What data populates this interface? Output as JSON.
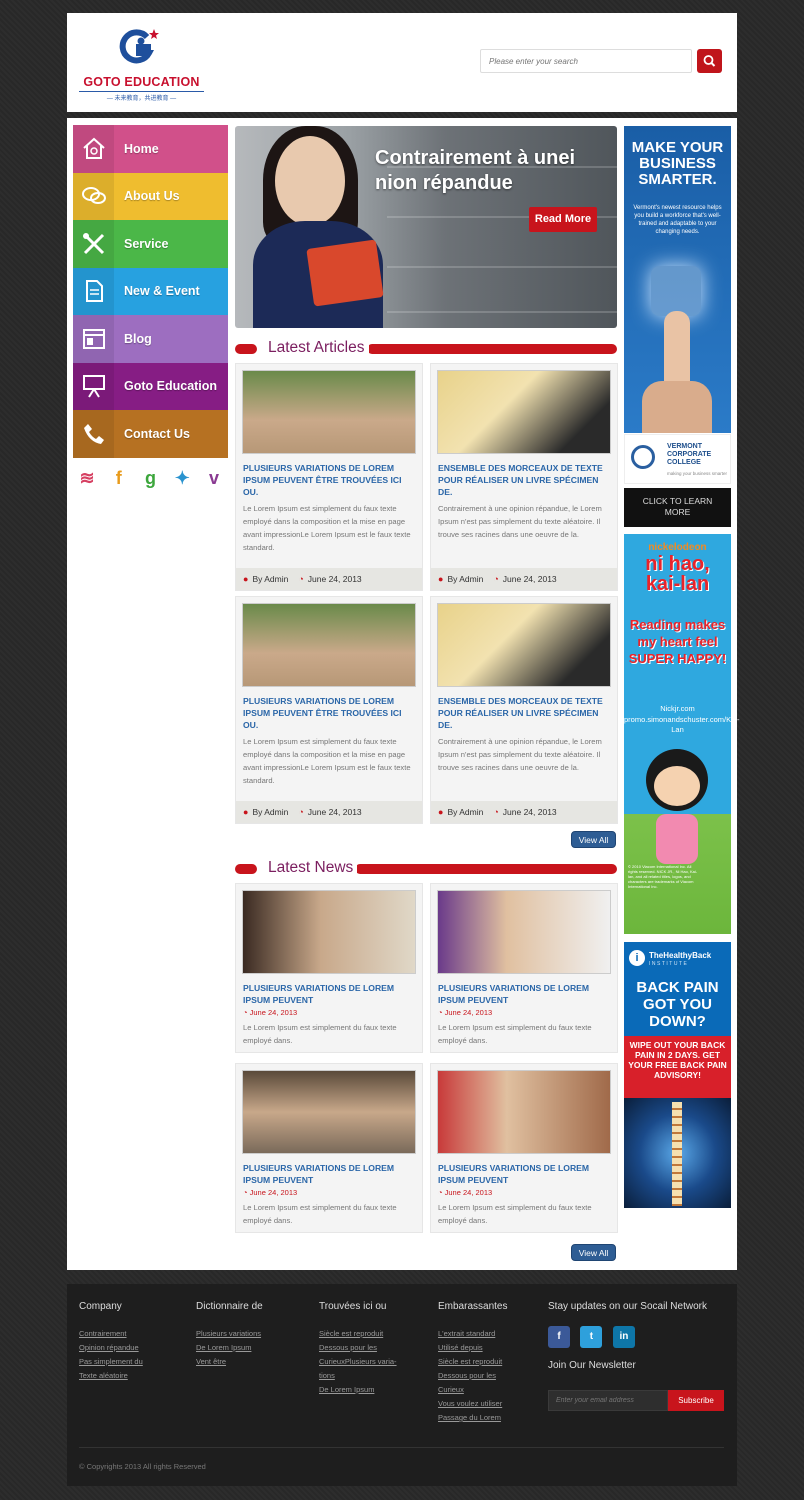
{
  "brand": {
    "name": "GOTO EDUCATION",
    "tagline": "— 未来教育，共进教育 —"
  },
  "search": {
    "placeholder": "Please enter your search"
  },
  "nav": [
    {
      "label": "Home",
      "icon": "home-icon",
      "color": "#d1508a"
    },
    {
      "label": "About Us",
      "icon": "chat-icon",
      "color": "#efbd2f"
    },
    {
      "label": "Service",
      "icon": "tools-icon",
      "color": "#4bb748"
    },
    {
      "label": "New & Event",
      "icon": "document-icon",
      "color": "#27a1e0"
    },
    {
      "label": "Blog",
      "icon": "browser-icon",
      "color": "#9d6ec0"
    },
    {
      "label": "Goto Education",
      "icon": "presentation-icon",
      "color": "#861d84"
    },
    {
      "label": "Contact Us",
      "icon": "phone-icon",
      "color": "#b67122"
    }
  ],
  "social_sidebar": [
    {
      "icon": "rss-icon",
      "glyph": "≋",
      "color": "#d64062"
    },
    {
      "icon": "facebook-icon",
      "glyph": "f",
      "color": "#e89b1c"
    },
    {
      "icon": "google-icon",
      "glyph": "g",
      "color": "#3ca63c"
    },
    {
      "icon": "twitter-icon",
      "glyph": "✦",
      "color": "#2a93cf"
    },
    {
      "icon": "vimeo-icon",
      "glyph": "v",
      "color": "#8a3a92"
    }
  ],
  "banner": {
    "title": "Contrairement à unei nion répandue",
    "button": "Read More"
  },
  "latest_articles": {
    "heading": "Latest Articles",
    "items": [
      {
        "title": "PLUSIEURS VARIATIONS DE LOREM IPSUM PEUVENT ÊTRE TROUVÉES ICI OU.",
        "text": "Le Lorem Ipsum est simplement du faux texte employé dans la composition et la mise en page avant impressionLe Lorem Ipsum est le faux texte standard.",
        "author": "By Admin",
        "date": "June 24, 2013"
      },
      {
        "title": "ENSEMBLE DES MORCEAUX DE TEXTE POUR RÉALISER UN LIVRE SPÉCIMEN DE.",
        "text": "Contrairement à une opinion répandue, le Lorem Ipsum n'est pas simplement du texte aléatoire. Il trouve ses racines dans une oeuvre de la.",
        "author": "By Admin",
        "date": "June 24, 2013"
      },
      {
        "title": "PLUSIEURS VARIATIONS DE LOREM IPSUM PEUVENT ÊTRE TROUVÉES ICI OU.",
        "text": "Le Lorem Ipsum est simplement du faux texte employé dans la composition et la mise en page avant impressionLe Lorem Ipsum est le faux texte standard.",
        "author": "By Admin",
        "date": "June 24, 2013"
      },
      {
        "title": "ENSEMBLE DES MORCEAUX DE TEXTE POUR RÉALISER UN LIVRE SPÉCIMEN DE.",
        "text": "Contrairement à une opinion répandue, le Lorem Ipsum n'est pas simplement du texte aléatoire. Il trouve ses racines dans une oeuvre de la.",
        "author": "By Admin",
        "date": "June 24, 2013"
      }
    ],
    "view_all": "View All"
  },
  "latest_news": {
    "heading": "Latest News",
    "items": [
      {
        "title": "PLUSIEURS VARIATIONS DE LOREM IPSUM PEUVENT",
        "date": "June 24, 2013",
        "text": "Le Lorem Ipsum est simplement du faux texte employé dans."
      },
      {
        "title": "PLUSIEURS VARIATIONS DE LOREM IPSUM PEUVENT",
        "date": "June 24, 2013",
        "text": "Le Lorem Ipsum est simplement du faux texte employé dans."
      },
      {
        "title": "PLUSIEURS VARIATIONS DE LOREM IPSUM PEUVENT",
        "date": "June 24, 2013",
        "text": "Le Lorem Ipsum est simplement du faux texte employé dans."
      },
      {
        "title": "PLUSIEURS VARIATIONS DE LOREM IPSUM PEUVENT",
        "date": "June 24, 2013",
        "text": "Le Lorem Ipsum est simplement du faux texte employé dans."
      }
    ],
    "view_all": "View All"
  },
  "ads": {
    "vermont": {
      "headline": "MAKE YOUR BUSINESS SMARTER.",
      "body": "Vermont's newest resource helps you build a workforce that's well-trained and adaptable to your changing needs.",
      "college": "VERMONT CORPORATE COLLEGE",
      "college_sub": "making your business smarter",
      "cta": "CLICK TO LEARN MORE"
    },
    "nihao": {
      "brand": "nickelodeon",
      "title": "ni hao, kai-lan",
      "slogan": "Reading makes my heart feel SUPER HAPPY!",
      "url1": "Nickjr.com",
      "url2": "promo.simonandschuster.com/Kai-Lan",
      "legal": "© 2010 Viacom International Inc. All rights reserved. NICK JR., Ni Hao, Kai-lan, and all related titles, logos, and characters are trademarks of Viacom International Inc."
    },
    "back": {
      "brand": "TheHealthyBack",
      "brand_sub": "INSTITUTE",
      "headline": "BACK PAIN GOT YOU DOWN?",
      "sub": "WIPE OUT YOUR BACK PAIN IN 2 DAYS. GET YOUR FREE BACK PAIN ADVISORY!"
    }
  },
  "footer": {
    "columns": [
      {
        "title": "Company",
        "links": [
          "Contrairement",
          "Opinion répandue",
          "Pas simplement du",
          "Texte aléatoire"
        ]
      },
      {
        "title": "Dictionnaire de",
        "links": [
          "Plusieurs variations",
          "De Lorem Ipsum",
          "Vent être"
        ]
      },
      {
        "title": "Trouvées ici ou",
        "links": [
          "Siècle est reproduit",
          "Dessous pour les",
          "CurieuxPlusieurs varia-",
          "tions",
          "De Lorem Ipsum"
        ]
      },
      {
        "title": "Embarassantes",
        "links": [
          "L'extrait standard",
          "Utilisé depuis",
          "Siècle est reproduit",
          "Dessous pour les",
          "Curieux",
          "Vous voulez utiliser",
          "Passage du Lorem"
        ]
      }
    ],
    "social_title": "Stay updates on our Socail Network",
    "social": [
      {
        "icon": "facebook-icon",
        "glyph": "f"
      },
      {
        "icon": "twitter-icon",
        "glyph": "t"
      },
      {
        "icon": "linkedin-icon",
        "glyph": "in"
      }
    ],
    "newsletter_title": "Join Our Newsletter",
    "email_placeholder": "Enter your email address",
    "subscribe": "Subscribe",
    "copyright": "© Copyrights 2013 All rights Reserved"
  }
}
